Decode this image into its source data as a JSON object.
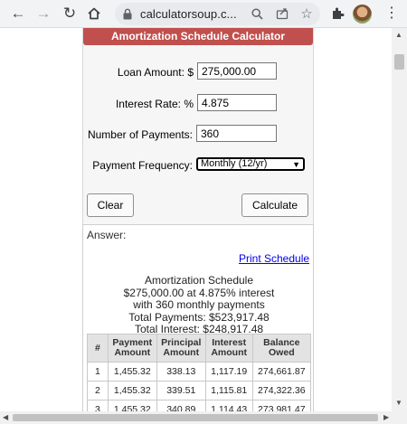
{
  "browser": {
    "url": "calculatorsoup.c...",
    "icons": [
      "back-arrow-icon",
      "forward-arrow-icon",
      "reload-icon",
      "home-icon",
      "lock-icon",
      "search-icon",
      "share-icon",
      "star-icon",
      "extensions-icon",
      "avatar",
      "menu-dots-icon"
    ]
  },
  "calculator": {
    "title": "Amortization Schedule Calculator",
    "loan_amount_label": "Loan Amount: $",
    "loan_amount_value": "275,000.00",
    "interest_rate_label": "Interest Rate: %",
    "interest_rate_value": "4.875",
    "num_payments_label": "Number of Payments:",
    "num_payments_value": "360",
    "frequency_label": "Payment Frequency:",
    "frequency_value": "Monthly (12/yr)",
    "clear_label": "Clear",
    "calculate_label": "Calculate",
    "title_color": "#c0504d"
  },
  "answer": {
    "label": "Answer:",
    "print_link": "Print Schedule",
    "summary": {
      "line1": "Amortization Schedule",
      "line2": "$275,000.00 at 4.875% interest",
      "line3": "with 360 monthly payments",
      "line4": "Total Payments: $523,917.48",
      "line5": "Total Interest: $248,917.48"
    },
    "table": {
      "headers": {
        "num": "#",
        "payment_1": "Payment",
        "payment_2": "Amount",
        "principal_1": "Principal",
        "principal_2": "Amount",
        "interest_1": "Interest",
        "interest_2": "Amount",
        "balance_1": "Balance",
        "balance_2": "Owed"
      },
      "rows": [
        {
          "num": "1",
          "payment": "1,455.32",
          "principal": "338.13",
          "interest": "1,117.19",
          "balance": "274,661.87"
        },
        {
          "num": "2",
          "payment": "1,455.32",
          "principal": "339.51",
          "interest": "1,115.81",
          "balance": "274,322.36"
        },
        {
          "num": "3",
          "payment": "1,455.32",
          "principal": "340.89",
          "interest": "1,114.43",
          "balance": "273,981.47"
        }
      ]
    }
  }
}
